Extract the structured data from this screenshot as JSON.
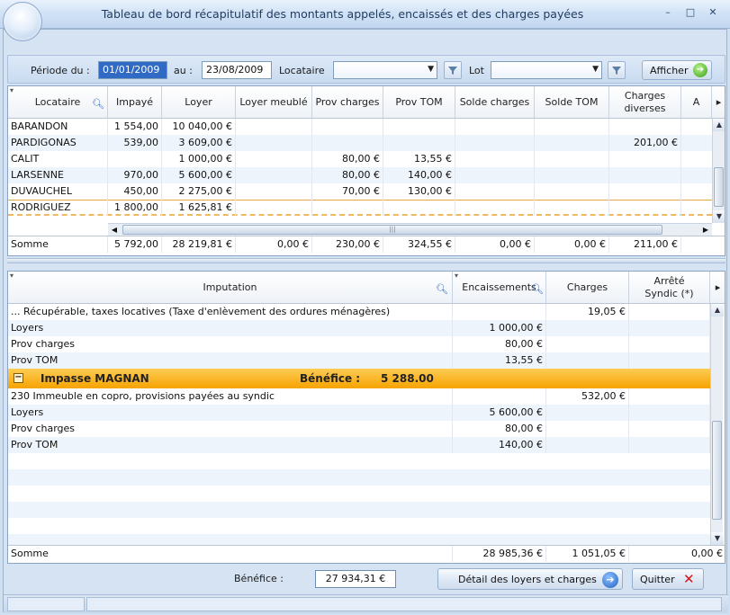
{
  "window": {
    "title": "Tableau de bord récapitulatif des montants appelés, encaissés et des charges payées",
    "controls": [
      "–",
      "□",
      "✕"
    ]
  },
  "filters": {
    "periode_label": "Période du :",
    "date_from": "01/01/2009",
    "au_label": "au :",
    "date_to": "23/08/2009",
    "locataire_label": "Locataire",
    "locataire_value": "",
    "lot_label": "Lot",
    "lot_value": "",
    "afficher_label": "Afficher"
  },
  "top_grid": {
    "columns": [
      "Locataire",
      "Impayé",
      "Loyer",
      "Loyer meublé",
      "Prov charges",
      "Prov TOM",
      "Solde charges",
      "Solde TOM",
      "Charges diverses",
      "A"
    ],
    "rows": [
      [
        "BARANDON",
        "1 554,00",
        "10 040,00 €",
        "",
        "",
        "",
        "",
        "",
        ""
      ],
      [
        "PARDIGONAS",
        "539,00",
        "3 609,00 €",
        "",
        "",
        "",
        "",
        "",
        "201,00 €"
      ],
      [
        "CALIT",
        "",
        "1 000,00 €",
        "",
        "80,00 €",
        "13,55 €",
        "",
        "",
        ""
      ],
      [
        "LARSENNE",
        "970,00",
        "5 600,00 €",
        "",
        "80,00 €",
        "140,00 €",
        "",
        "",
        ""
      ],
      [
        "DUVAUCHEL",
        "450,00",
        "2 275,00 €",
        "",
        "70,00 €",
        "130,00 €",
        "",
        "",
        ""
      ],
      [
        "RODRIGUEZ",
        "1 800,00",
        "1 625,81 €",
        "",
        "",
        "",
        "",
        "",
        ""
      ]
    ],
    "sum": [
      "Somme",
      "5 792,00",
      "28 219,81 €",
      "0,00 €",
      "230,00 €",
      "324,55 €",
      "0,00 €",
      "0,00 €",
      "211,00 €"
    ]
  },
  "bottom_grid": {
    "columns": [
      "Imputation",
      "Encaissements",
      "Charges",
      "Arrêté Syndic (*)"
    ],
    "rows_before": [
      [
        "... Récupérable, taxes locatives (Taxe d'enlèvement des ordures ménagères)",
        "",
        "19,05 €",
        ""
      ],
      [
        "Loyers",
        "1 000,00 €",
        "",
        ""
      ],
      [
        "Prov charges",
        "80,00 €",
        "",
        ""
      ],
      [
        "Prov TOM",
        "13,55 €",
        "",
        ""
      ]
    ],
    "group": {
      "toggle": "−",
      "name": "Impasse MAGNAN",
      "benefice_label": "Bénéfice :",
      "benefice_value": "5 288.00"
    },
    "rows_after": [
      [
        "230 Immeuble en copro, provisions payées au syndic",
        "",
        "532,00 €",
        ""
      ],
      [
        "Loyers",
        "5 600,00 €",
        "",
        ""
      ],
      [
        "Prov charges",
        "80,00 €",
        "",
        ""
      ],
      [
        "Prov TOM",
        "140,00 €",
        "",
        ""
      ]
    ],
    "sum": [
      "Somme",
      "28 985,36 €",
      "1 051,05 €",
      "0,00 €"
    ]
  },
  "footer": {
    "benefice_label": "Bénéfice :",
    "benefice_value": "27 934,31 €",
    "detail_label": "Détail des loyers et charges",
    "quit_label": "Quitter"
  },
  "colors": {
    "accent": "#316ac5",
    "group_bar": "#f5a300",
    "window_bg": "#d5e3f3"
  }
}
